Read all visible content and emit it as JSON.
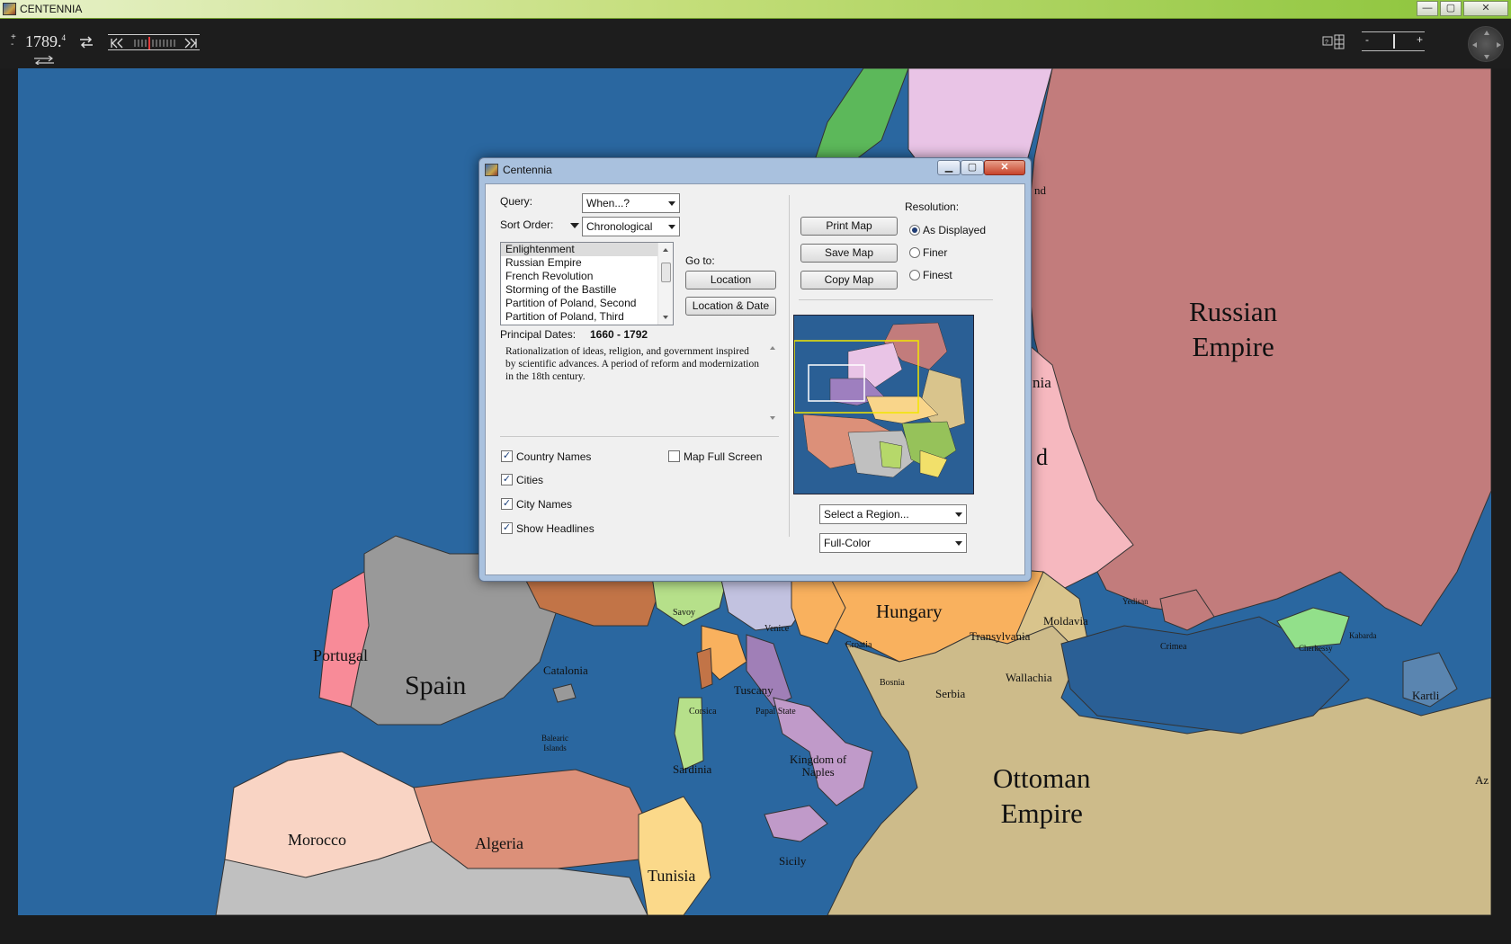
{
  "window": {
    "title": "CENTENNIA",
    "buttons": {
      "minimize": "—",
      "maximize": "▢",
      "close": "✕"
    }
  },
  "toolbar": {
    "year": "1789.",
    "year_fraction": "4",
    "zoom_minus": "-",
    "zoom_plus": "+",
    "icons": [
      "step-up-icon",
      "swap-arrows-icon",
      "timeline-slider",
      "map-mode-icon",
      "grid-icon",
      "zoom-slider",
      "nav-wheel-icon"
    ]
  },
  "map": {
    "labels": {
      "russian_empire": "Russian\nEmpire",
      "ottoman_empire": "Ottoman\nEmpire",
      "spain": "Spain",
      "portugal": "Portugal",
      "hungary": "Hungary",
      "morocco": "Morocco",
      "algeria": "Algeria",
      "tunisia": "Tunisia",
      "catalonia": "Catalonia",
      "transylvania": "Transylvania",
      "moldavia": "Moldavia",
      "wallachia": "Wallachia",
      "serbia": "Serbia",
      "bosnia": "Bosnia",
      "croatia": "Croatia",
      "venice": "Venice",
      "savoy": "Savoy",
      "tuscany": "Tuscany",
      "papal_state": "Papal State",
      "kingdom_of_naples": "Kingdom of\nNaples",
      "sicily": "Sicily",
      "sardinia": "Sardinia",
      "corsica": "Corsica",
      "balearic": "Balearic\nIslands",
      "crimea": "Crimea",
      "yedisan": "Yedisan",
      "cherkessy": "Cherkessy",
      "kabarda": "Kabarda",
      "kartli": "Kartli",
      "az": "Az",
      "frag_nd1": "nd",
      "frag_nia": "nia",
      "frag_nd2": "d"
    }
  },
  "dialog": {
    "title": "Centennia",
    "query_label": "Query:",
    "query_value": "When...?",
    "sort_label": "Sort Order:",
    "sort_value": "Chronological",
    "events": [
      "Enlightenment",
      "Russian Empire",
      "French Revolution",
      "Storming of the Bastille",
      "Partition of Poland, Second",
      "Partition of Poland, Third"
    ],
    "selected_event": "Enlightenment",
    "goto_label": "Go to:",
    "location_button": "Location",
    "location_date_button": "Location & Date",
    "principal_dates_label": "Principal Dates:",
    "principal_dates_value": "1660 - 1792",
    "description": "Rationalization of ideas, religion, and government inspired by scientific advances. A period of reform and modernization in the 18th century.",
    "print_map": "Print Map",
    "save_map": "Save Map",
    "copy_map": "Copy Map",
    "resolution_label": "Resolution:",
    "resolution_options": [
      "As Displayed",
      "Finer",
      "Finest"
    ],
    "resolution_selected": "As Displayed",
    "checkboxes": {
      "country_names": {
        "label": "Country Names",
        "checked": true
      },
      "cities": {
        "label": "Cities",
        "checked": true
      },
      "city_names": {
        "label": "City Names",
        "checked": true
      },
      "show_headlines": {
        "label": "Show Headlines",
        "checked": true
      },
      "map_full_screen": {
        "label": "Map Full Screen",
        "checked": false
      }
    },
    "region_select": "Select a Region...",
    "color_select": "Full-Color"
  }
}
